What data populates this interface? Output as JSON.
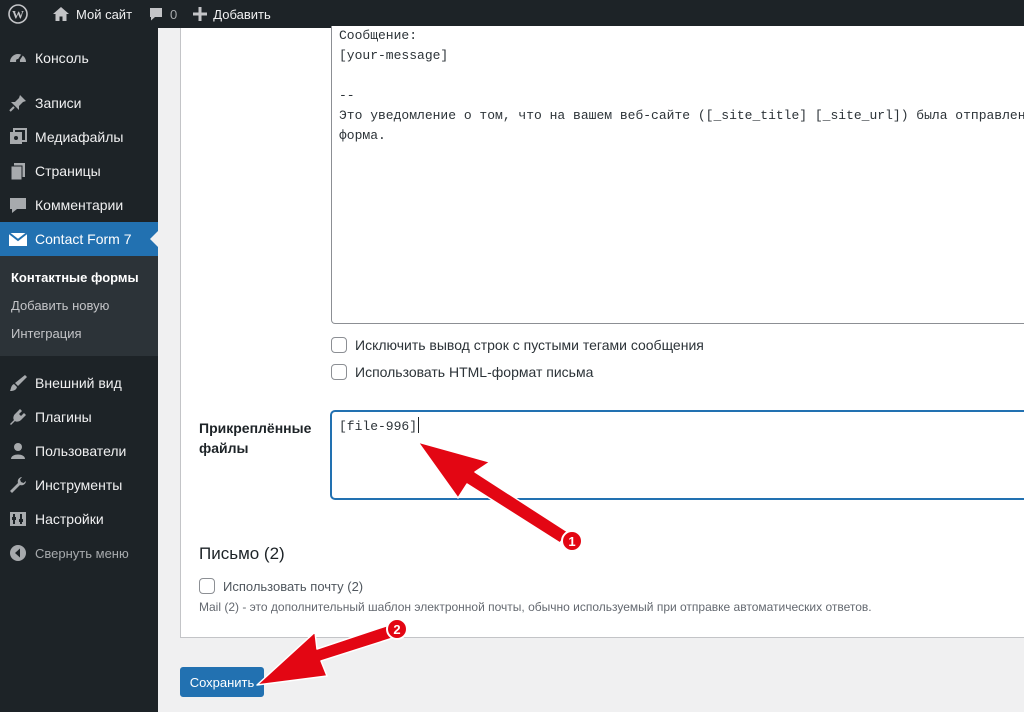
{
  "adminbar": {
    "site_name": "Мой сайт",
    "comments_count": "0",
    "add_new": "Добавить"
  },
  "sidebar": {
    "items": [
      {
        "label": "Консоль",
        "icon": "dashboard-icon"
      },
      {
        "label": "Записи",
        "icon": "pin-icon"
      },
      {
        "label": "Медиафайлы",
        "icon": "media-icon"
      },
      {
        "label": "Страницы",
        "icon": "pages-icon"
      },
      {
        "label": "Комментарии",
        "icon": "comment-icon"
      },
      {
        "label": "Contact Form 7",
        "icon": "mail-icon"
      },
      {
        "label": "Внешний вид",
        "icon": "brush-icon"
      },
      {
        "label": "Плагины",
        "icon": "plugin-icon"
      },
      {
        "label": "Пользователи",
        "icon": "user-icon"
      },
      {
        "label": "Инструменты",
        "icon": "wrench-icon"
      },
      {
        "label": "Настройки",
        "icon": "settings-icon"
      }
    ],
    "submenu": [
      "Контактные формы",
      "Добавить новую",
      "Интеграция"
    ],
    "collapse": "Свернуть меню"
  },
  "mail": {
    "body_lines": [
      "Сообщение:",
      "[your-message]",
      "",
      "--",
      "Это уведомление о том, что на вашем веб-сайте ([_site_title] [_site_url]) была отправлена",
      "форма."
    ],
    "exclude_blank_label": "Исключить вывод строк с пустыми тегами сообщения",
    "html_format_label": "Использовать HTML-формат письма",
    "attachments_label": "Прикреплённые файлы",
    "attachments_value": "[file-996]"
  },
  "mail2": {
    "title": "Письмо (2)",
    "use_label": "Использовать почту (2)",
    "description": "Mail (2) - это дополнительный шаблон электронной почты, обычно используемый при отправке автоматических ответов."
  },
  "save_label": "Сохранить",
  "annotations": {
    "badge1": "1",
    "badge2": "2",
    "color": "#e30613"
  }
}
